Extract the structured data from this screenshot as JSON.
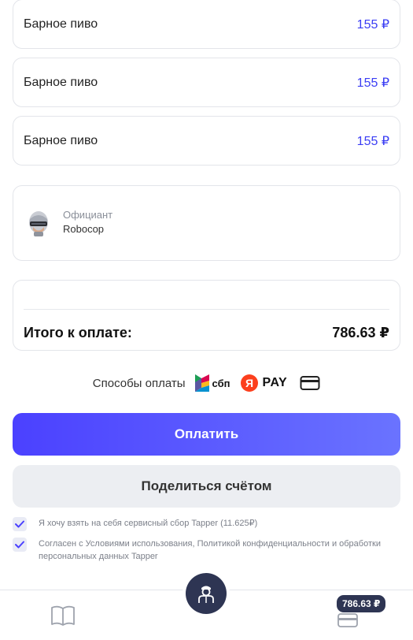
{
  "items": [
    {
      "name": "Барное пиво",
      "price": "155 ₽"
    },
    {
      "name": "Барное пиво",
      "price": "155 ₽"
    },
    {
      "name": "Барное пиво",
      "price": "155 ₽"
    }
  ],
  "waiter": {
    "role": "Официант",
    "name": "Robocop",
    "avatar_icon": "robocop-avatar"
  },
  "total": {
    "label": "Итого к оплате:",
    "value": "786.63 ₽"
  },
  "payment_methods": {
    "label": "Способы оплаты",
    "sbp_label": "сбп",
    "ypay_letter": "Я",
    "ypay_label": "PAY",
    "icons": [
      "sbp-icon",
      "yandex-pay-icon",
      "bank-card-icon"
    ]
  },
  "buttons": {
    "pay": "Оплатить",
    "share": "Поделиться счётом"
  },
  "checkboxes": [
    {
      "text": "Я хочу взять на себя сервисный сбор Tapper (11.625₽)",
      "checked": true
    },
    {
      "text": "Согласен с Условиями использования, Политикой конфиденциальности и обработки персональных данных Tapper",
      "checked": true
    }
  ],
  "bottom_nav": {
    "badge": "786.63 ₽",
    "icons": [
      "menu-book-icon",
      "waiter-icon",
      "wallet-icon"
    ]
  },
  "colors": {
    "accent": "#4b41ff",
    "price": "#3a3df4",
    "nav_dark": "#2e3553"
  }
}
